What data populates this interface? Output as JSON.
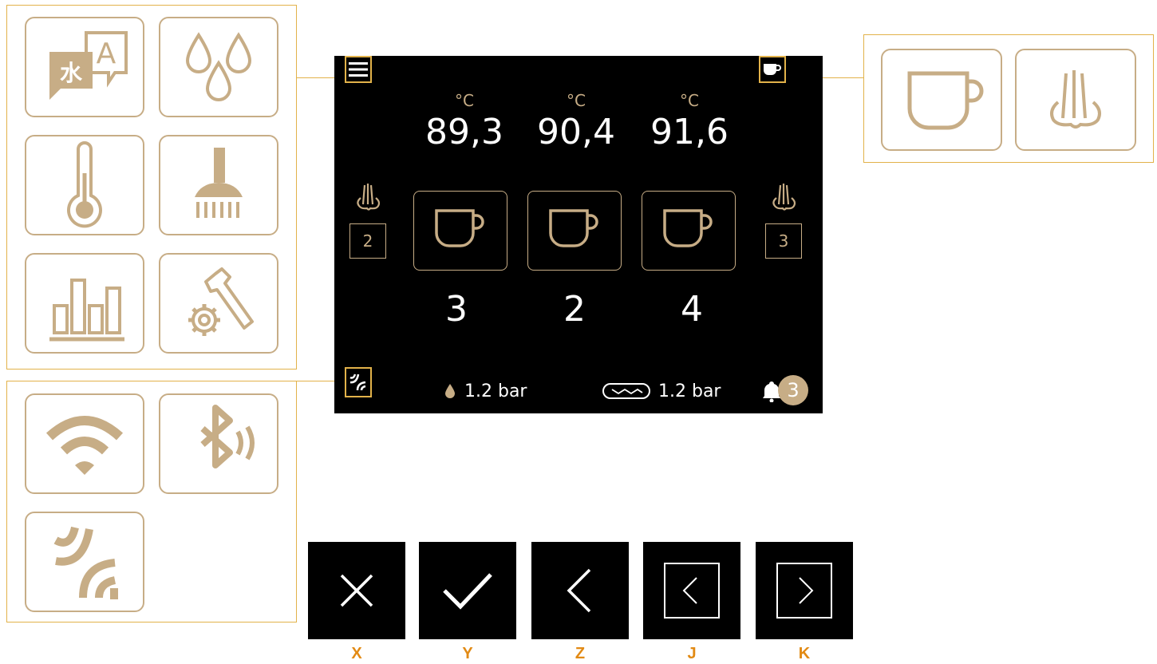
{
  "screen": {
    "temperatures": [
      {
        "unit": "°C",
        "value": "89,3"
      },
      {
        "unit": "°C",
        "value": "90,4"
      },
      {
        "unit": "°C",
        "value": "91,6"
      }
    ],
    "cup_counts": [
      "3",
      "2",
      "4"
    ],
    "steam_left": "2",
    "steam_right": "3",
    "water_pressure": "1.2 bar",
    "pump_pressure": "1.2 bar",
    "notification_count": "3"
  },
  "menu_tiles": [
    "language-icon",
    "water-drops-icon",
    "thermometer-icon",
    "cleaning-brush-icon",
    "statistics-icon",
    "service-settings-icon"
  ],
  "connectivity_tiles": [
    "wifi-icon",
    "bluetooth-icon",
    "nfc-icon"
  ],
  "brew_tiles": [
    "cup-icon",
    "steam-icon"
  ],
  "nav_buttons": [
    {
      "key": "X",
      "icon": "close-icon"
    },
    {
      "key": "Y",
      "icon": "check-icon"
    },
    {
      "key": "Z",
      "icon": "back-icon"
    },
    {
      "key": "J",
      "icon": "prev-boxed-icon"
    },
    {
      "key": "K",
      "icon": "next-boxed-icon"
    }
  ],
  "colors": {
    "gold": "#c7ad86",
    "frame": "#e2b24a",
    "label": "#e28a14",
    "screen": "#000000"
  }
}
